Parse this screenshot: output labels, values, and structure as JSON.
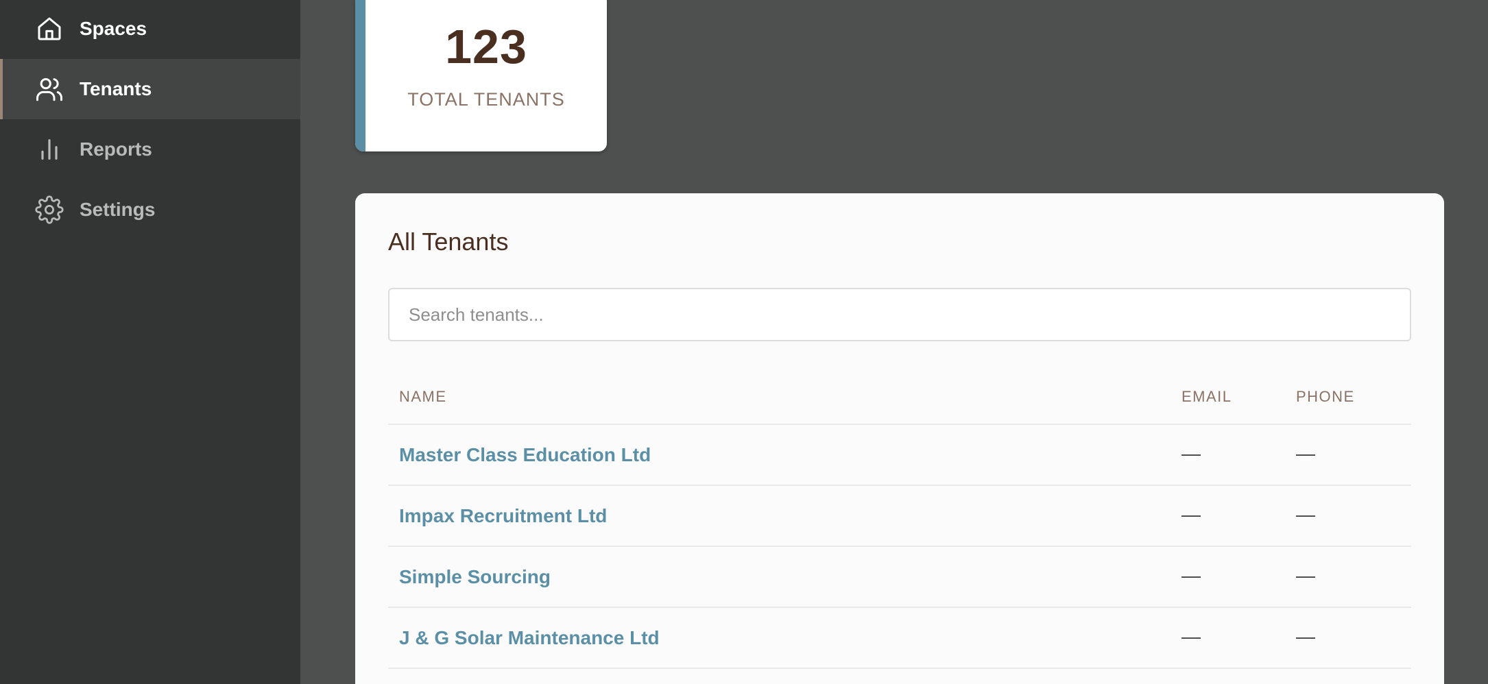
{
  "sidebar": {
    "items": [
      {
        "label": "Spaces",
        "icon": "home-icon"
      },
      {
        "label": "Tenants",
        "icon": "users-icon",
        "active": true
      },
      {
        "label": "Reports",
        "icon": "bar-chart-icon"
      },
      {
        "label": "Settings",
        "icon": "gear-icon"
      }
    ]
  },
  "stats": {
    "total_tenants_value": "123",
    "total_tenants_label": "TOTAL TENANTS"
  },
  "tenants_panel": {
    "title": "All Tenants",
    "search_placeholder": "Search tenants...",
    "columns": [
      "NAME",
      "EMAIL",
      "PHONE"
    ],
    "rows": [
      {
        "name": "Master Class Education Ltd",
        "email": "—",
        "phone": "—"
      },
      {
        "name": "Impax Recruitment Ltd",
        "email": "—",
        "phone": "—"
      },
      {
        "name": "Simple Sourcing",
        "email": "—",
        "phone": "—"
      },
      {
        "name": "J & G Solar Maintenance Ltd",
        "email": "—",
        "phone": "—"
      }
    ]
  },
  "colors": {
    "accent": "#5b8fa6",
    "brand_text": "#4a2e1f",
    "muted_text": "#8a7264",
    "sidebar_bg": "#333534",
    "page_bg": "#4e5050"
  }
}
